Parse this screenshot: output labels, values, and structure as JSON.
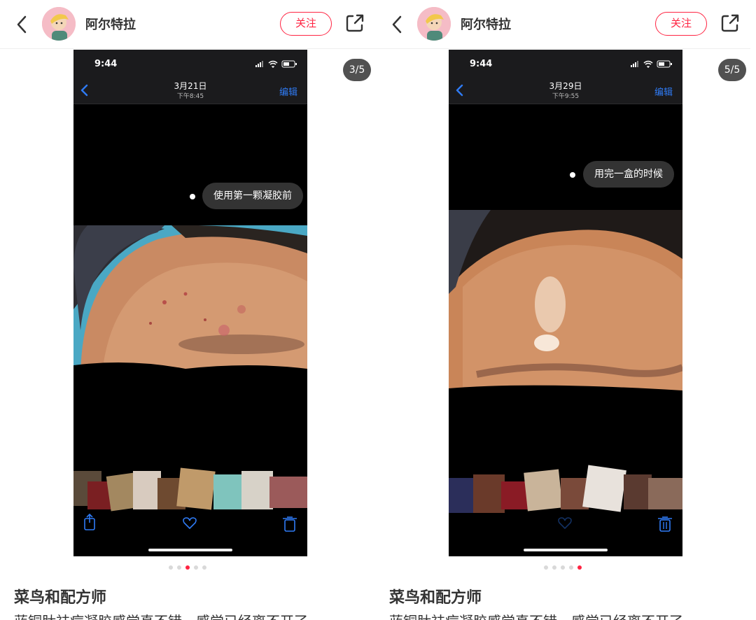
{
  "colors": {
    "accent": "#ff2442",
    "ios_blue": "#2f7bf5",
    "dot_inactive": "#d9d9d9"
  },
  "panels": [
    {
      "header": {
        "author": "阿尔特拉",
        "follow_label": "关注",
        "back_icon": "chevron-left-icon",
        "share_icon": "share-icon"
      },
      "counter": "3/5",
      "phone": {
        "time": "9:44",
        "date": "3月21日",
        "subtime": "下午8:45",
        "edit_label": "编辑",
        "tag": "使用第一颗凝胶前"
      },
      "carousel": {
        "total": 5,
        "active_index": 2
      },
      "post": {
        "title": "菜鸟和配方师",
        "desc": "蓝铜肽祛痘凝胶感觉真不错，感觉已经离不开了"
      }
    },
    {
      "header": {
        "author": "阿尔特拉",
        "follow_label": "关注",
        "back_icon": "chevron-left-icon",
        "share_icon": "share-icon"
      },
      "counter": "5/5",
      "phone": {
        "time": "9:44",
        "date": "3月29日",
        "subtime": "下午9:55",
        "edit_label": "编辑",
        "tag": "用完一盒的时候"
      },
      "carousel": {
        "total": 5,
        "active_index": 4
      },
      "post": {
        "title": "菜鸟和配方师",
        "desc": "蓝铜肽祛痘凝胶感觉真不错，感觉已经离不开了"
      }
    }
  ]
}
